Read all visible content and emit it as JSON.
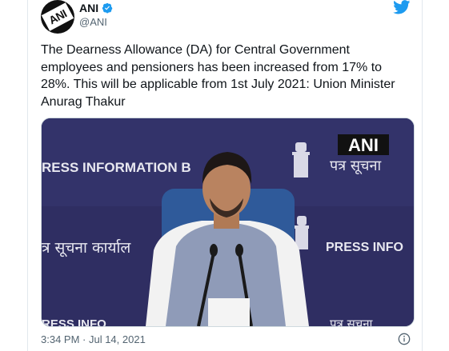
{
  "tweet": {
    "author_name": "ANI",
    "author_handle": "@ANI",
    "avatar_text": "ANI",
    "text": "The Dearness Allowance (DA) for Central Government employees and pensioners has been increased from 17% to 28%. This will be applicable from 1st July 2021: Union Minister Anurag Thakur",
    "timestamp": "3:34 PM · Jul 14, 2021"
  },
  "media": {
    "watermark": "ANI",
    "backdrop_left_text": "RESS INFORMATION B",
    "backdrop_right_hindi": "पत्र सूचना",
    "backdrop_left_hindi": "त्र सूचना कार्याल",
    "backdrop_right_text": "PRESS INFO",
    "backdrop_bottom_left": "RESS INFO",
    "backdrop_bottom_right": "पत्र सूचना"
  },
  "icons": {
    "twitter": "twitter-bird-icon",
    "verified": "verified-badge-icon",
    "info": "info-icon"
  },
  "colors": {
    "twitter_blue": "#1d9bf0",
    "text": "#0f1419",
    "secondary_text": "#536471",
    "backdrop": "#2b2a5c"
  }
}
